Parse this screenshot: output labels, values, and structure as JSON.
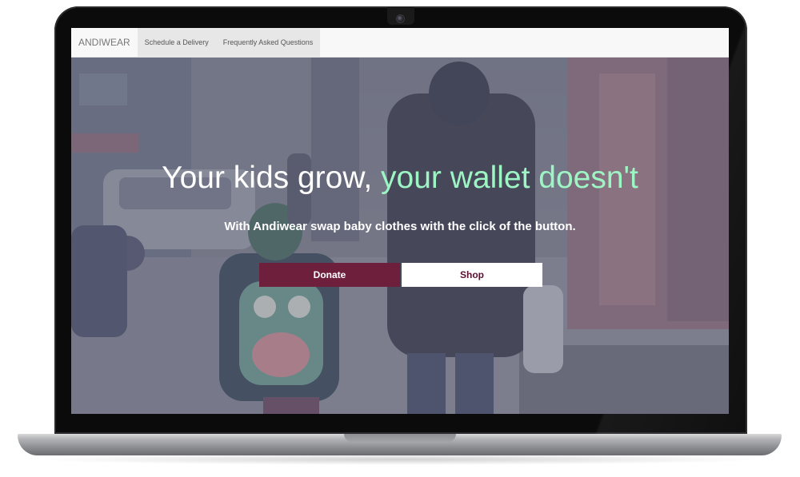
{
  "navbar": {
    "brand": "ANDIWEAR",
    "items": [
      {
        "label": "Schedule a Delivery"
      },
      {
        "label": "Frequently Asked Questions"
      }
    ]
  },
  "hero": {
    "headline_main": "Your kids grow, ",
    "headline_accent": "your wallet doesn't",
    "subtitle": "With Andiwear swap baby clothes with the click of the button.",
    "donate_label": "Donate",
    "shop_label": "Shop"
  },
  "colors": {
    "accent_text": "#9ef5c4",
    "donate_button": "#6e1f3c",
    "shop_button_text": "#5a1030",
    "navbar_bg": "#f8f8f8"
  },
  "icons": {
    "webcam": "webcam-icon"
  }
}
